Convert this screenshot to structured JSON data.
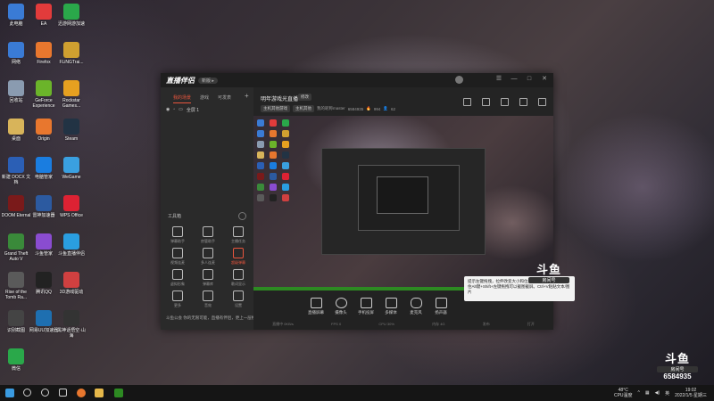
{
  "desktop": {
    "icons": [
      {
        "label": "此电脑",
        "color": "#3a7bd5"
      },
      {
        "label": "EA",
        "color": "#e23b3b"
      },
      {
        "label": "迅游网游加速",
        "color": "#2aa84a"
      },
      {
        "label": "网络",
        "color": "#3a7bd5"
      },
      {
        "label": "Firefox",
        "color": "#e8772e"
      },
      {
        "label": "FLiNGTrai...",
        "color": "#d0a030"
      },
      {
        "label": "回收站",
        "color": "#8a9bb0"
      },
      {
        "label": "GeForce Experience",
        "color": "#6bb42a"
      },
      {
        "label": "Rockstar Games...",
        "color": "#e6a020"
      },
      {
        "label": "桌面",
        "color": "#d8b45a"
      },
      {
        "label": "Origin",
        "color": "#e8772e"
      },
      {
        "label": "Steam",
        "color": "#234"
      },
      {
        "label": "新建 DOCX 文档",
        "color": "#2b5fb5"
      },
      {
        "label": "电脑管家",
        "color": "#1a7de0"
      },
      {
        "label": "WeGame",
        "color": "#3aa0e0"
      },
      {
        "label": "DOOM Eternal",
        "color": "#7a1a1a"
      },
      {
        "label": "雷神加速器",
        "color": "#2c5aa0"
      },
      {
        "label": "WPS Office",
        "color": "#d23"
      },
      {
        "label": "Grand Theft Auto V",
        "color": "#3a8a3a"
      },
      {
        "label": "斗鱼管家",
        "color": "#8a4cd0"
      },
      {
        "label": "斗鱼直播伴侣",
        "color": "#2a9ee0"
      },
      {
        "label": "Rise of the Tomb Ra...",
        "color": "#5a5a5a"
      },
      {
        "label": "腾讯QQ",
        "color": "#222"
      },
      {
        "label": "3D游戏驱动",
        "color": "#d04040"
      },
      {
        "label": "识别截图",
        "color": "#444"
      },
      {
        "label": "网易UU加速器",
        "color": "#1e6fb0"
      },
      {
        "label": "黑神话悟空·山海",
        "color": "#333"
      },
      {
        "label": "微信",
        "color": "#2aa84a"
      }
    ]
  },
  "app": {
    "logo": "直播伴侣",
    "version": "新版 ▸",
    "window_controls": [
      "☰",
      "—",
      "□",
      "✕"
    ],
    "left": {
      "tabs": [
        "我的场景",
        "游戏",
        "可发表"
      ],
      "scene_label": "全屏 1",
      "tools_title": "工具箱",
      "tools": [
        {
          "label": "弹幕助手"
        },
        {
          "label": "房管助手"
        },
        {
          "label": "主播任务"
        },
        {
          "label": "视频连麦"
        },
        {
          "label": "多人连麦"
        },
        {
          "label": "超级弹幕"
        },
        {
          "label": "虚拟形象"
        },
        {
          "label": "弹幕库"
        },
        {
          "label": "歌词显示"
        },
        {
          "label": "更多"
        },
        {
          "label": "音效"
        },
        {
          "label": "设置"
        }
      ],
      "footer": "斗鱼公会  你的无限可能，直播有伴侣，更上一层楼"
    },
    "header": {
      "title": "明年游戏光直播",
      "badge": "修改",
      "chips": [
        "主机其他游戏",
        "主机其他"
      ],
      "info": "我的昵称master",
      "room_id": "6584935",
      "fans": "994",
      "viewers": "62"
    },
    "bottom_buttons": [
      "直播屏幕",
      "摄像头",
      "手机投屏",
      "多媒体",
      "麦克风",
      "扬声器"
    ],
    "status": [
      "直播中 0KB/s",
      "FPS 0",
      "CPU 30%",
      "内存 4G",
      "发布",
      "打开"
    ]
  },
  "tooltip": "提示左键拖拽，拉伸改变大小和位置，右键调出菜单。按住Alt键+Shift+左键拖拽可以截图截屏。Ctrl+V粘贴文本/图片",
  "watermark_mid": {
    "logo": "斗鱼",
    "sub": "房间号"
  },
  "watermark_corner": {
    "logo": "斗鱼",
    "sub": "房间号",
    "room": "6584935"
  },
  "taskbar": {
    "temp": "48°C",
    "cpu": "CPU温度",
    "lang": "英",
    "time": "19:02",
    "date": "2022/1/5 星期三"
  }
}
